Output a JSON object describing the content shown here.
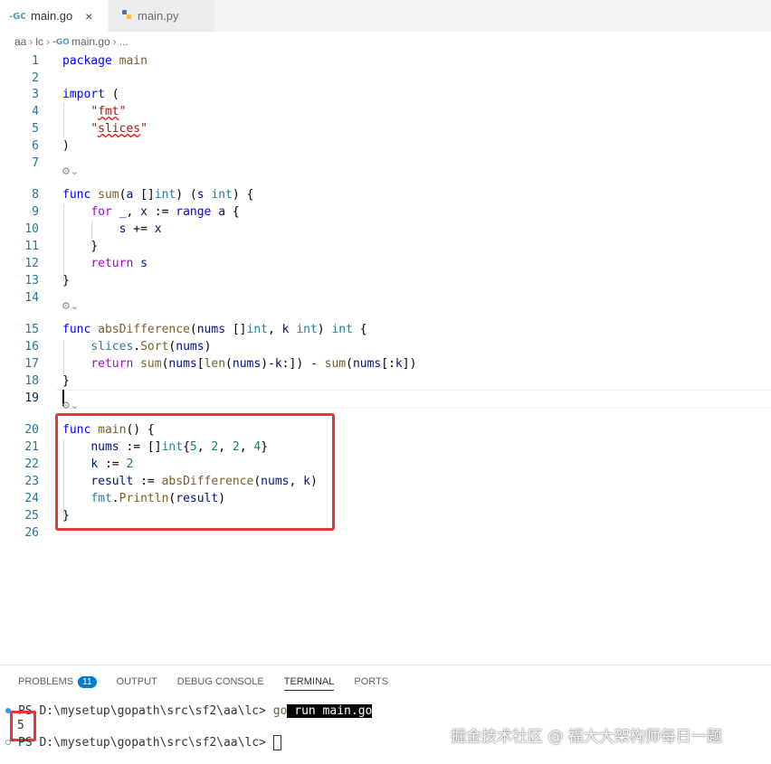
{
  "tabs": [
    {
      "label": "main.go",
      "icon": "go-file-icon",
      "active": true,
      "close": "×"
    },
    {
      "label": "main.py",
      "icon": "python-file-icon",
      "active": false
    }
  ],
  "breadcrumb": [
    "aa",
    "lc",
    "main.go",
    "..."
  ],
  "codelens": "⚙︎⌄",
  "editor": {
    "current_line": 19,
    "lines": [
      {
        "n": "1",
        "t": "package main"
      },
      {
        "n": "2",
        "t": ""
      },
      {
        "n": "3",
        "t": "import ("
      },
      {
        "n": "4",
        "t": "    \"fmt\""
      },
      {
        "n": "5",
        "t": "    \"slices\""
      },
      {
        "n": "6",
        "t": ")"
      },
      {
        "n": "7",
        "t": ""
      },
      {
        "n": "8",
        "t": "func sum(a []int) (s int) {"
      },
      {
        "n": "9",
        "t": "    for _, x := range a {"
      },
      {
        "n": "10",
        "t": "        s += x"
      },
      {
        "n": "11",
        "t": "    }"
      },
      {
        "n": "12",
        "t": "    return s"
      },
      {
        "n": "13",
        "t": "}"
      },
      {
        "n": "14",
        "t": ""
      },
      {
        "n": "15",
        "t": "func absDifference(nums []int, k int) int {"
      },
      {
        "n": "16",
        "t": "    slices.Sort(nums)"
      },
      {
        "n": "17",
        "t": "    return sum(nums[len(nums)-k:]) - sum(nums[:k])"
      },
      {
        "n": "18",
        "t": "}"
      },
      {
        "n": "19",
        "t": ""
      },
      {
        "n": "20",
        "t": "func main() {"
      },
      {
        "n": "21",
        "t": "    nums := []int{5, 2, 2, 4}"
      },
      {
        "n": "22",
        "t": "    k := 2"
      },
      {
        "n": "23",
        "t": "    result := absDifference(nums, k)"
      },
      {
        "n": "24",
        "t": "    fmt.Println(result)"
      },
      {
        "n": "25",
        "t": "}"
      },
      {
        "n": "26",
        "t": ""
      }
    ]
  },
  "panel": {
    "tabs": [
      "PROBLEMS",
      "OUTPUT",
      "DEBUG CONSOLE",
      "TERMINAL",
      "PORTS"
    ],
    "active_tab": "TERMINAL",
    "problems_count": "11"
  },
  "terminal": {
    "prompt1": "PS D:\\mysetup\\gopath\\src\\sf2\\aa\\lc> ",
    "cmd_go": "go",
    "cmd_rest": " run main.go",
    "output": "5",
    "prompt2": "PS D:\\mysetup\\gopath\\src\\sf2\\aa\\lc> "
  },
  "watermark": "掘金技术社区 @ 福大大架构师每日一题",
  "colors": {
    "highlight_box": "#e63737",
    "badge": "#007acc",
    "keyword": "#0000ff",
    "function": "#795e26",
    "type": "#267f99"
  }
}
